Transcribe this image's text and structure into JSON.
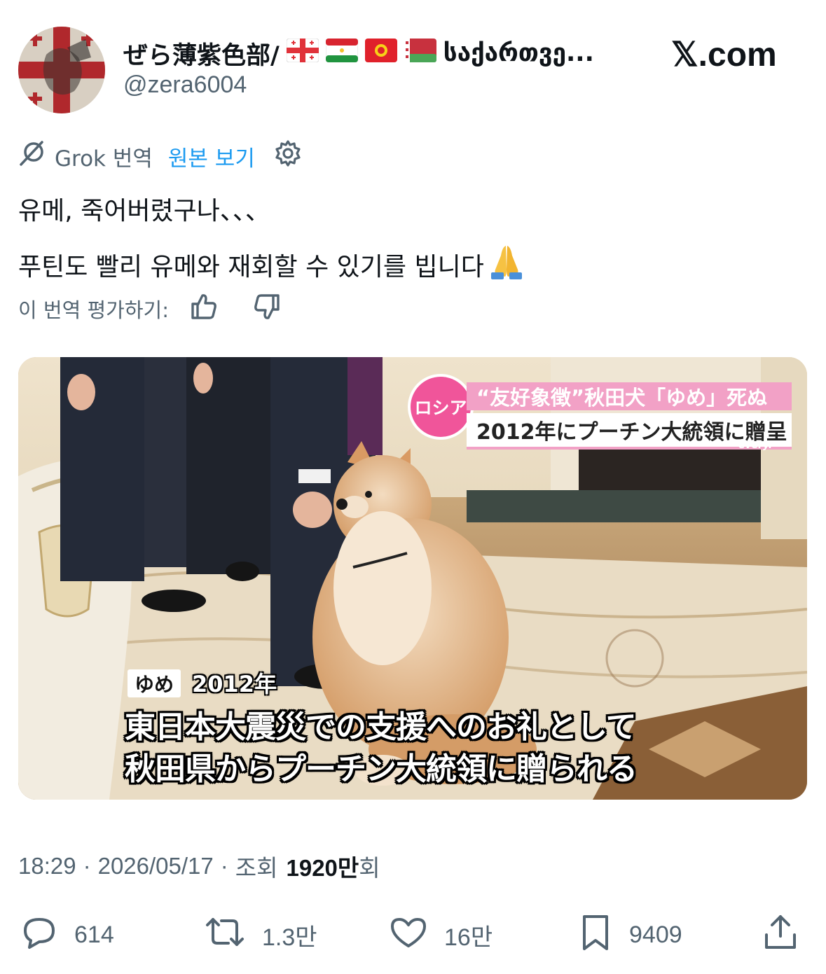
{
  "author": {
    "display_name": "ぜら薄紫色部/",
    "display_name_suffix": "საქართვე...",
    "flags": [
      "flag-georgia-icon",
      "flag-tajikistan-icon",
      "flag-kyrgyzstan-icon",
      "flag-belarus-icon"
    ],
    "handle": "@zera6004"
  },
  "site_label": "𝕏.com",
  "translation": {
    "provider": "Grok 번역",
    "show_original": "원본 보기",
    "icons": [
      "grok-icon",
      "gear-icon"
    ]
  },
  "tweet": {
    "line1": "유메, 죽어버렸구나、、、",
    "line2": "푸틴도 빨리 유메와 재회할 수 있기를 빕니다",
    "emoji": "pray-emoji"
  },
  "rate": {
    "label": "이 번역 평가하기:",
    "icons": [
      "thumbs-up-icon",
      "thumbs-down-icon"
    ]
  },
  "media": {
    "badge": "ロシア",
    "headline": "“友好象徴”秋田犬「ゆめ」死ぬ",
    "subheadline": "2012年にプーチン大統領に贈呈",
    "network": "every.",
    "name_tag": "ゆめ",
    "year": "2012年",
    "subtitle_line1": "東日本大震災での支援へのお礼として",
    "subtitle_line2": "秋田県からプーチン大統領に贈られる"
  },
  "meta": {
    "time": "18:29",
    "date": "2026/05/17",
    "views_label": "조회",
    "views_count": "1920만",
    "views_suffix": "회",
    "separator": "·"
  },
  "actions": {
    "replies": "614",
    "reposts": "1.3만",
    "likes": "16만",
    "bookmarks": "9409"
  },
  "colors": {
    "accent": "#1d9bf0",
    "muted": "#536471",
    "text": "#0f1419",
    "badge_pink": "#f0559a"
  }
}
